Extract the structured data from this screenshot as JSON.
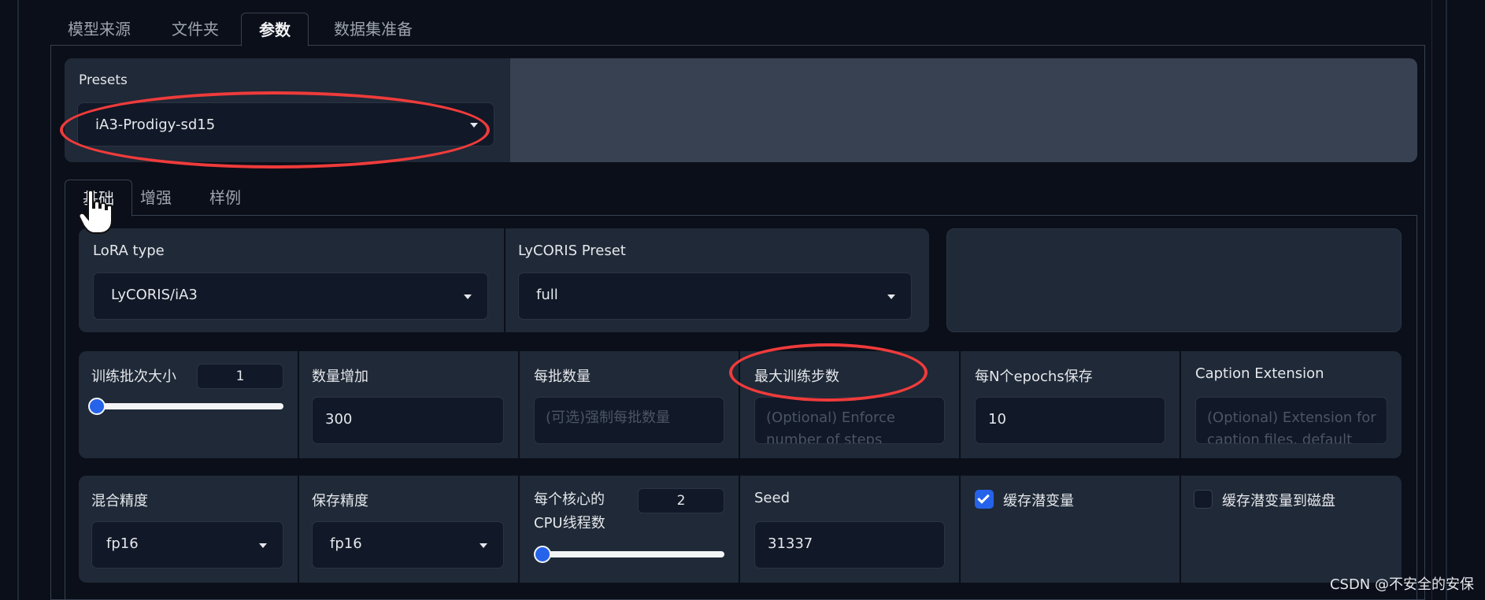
{
  "top_tabs": [
    {
      "label": "模型来源"
    },
    {
      "label": "文件夹"
    },
    {
      "label": "参数"
    },
    {
      "label": "数据集准备"
    }
  ],
  "presets": {
    "label": "Presets",
    "value": "iA3-Prodigy-sd15"
  },
  "sub_tabs": [
    {
      "label": "基础"
    },
    {
      "label": "增强"
    },
    {
      "label": "样例"
    }
  ],
  "lora": {
    "type_label": "LoRA type",
    "type_value": "LyCORIS/iA3",
    "preset_label": "LyCORIS Preset",
    "preset_value": "full"
  },
  "row2": {
    "batch_label": "训练批次大小",
    "batch_value": "1",
    "batch_slider_fraction": 0.0,
    "repeat_label": "数量增加",
    "repeat_value": "300",
    "per_batch_label": "每批数量",
    "per_batch_placeholder": "(可选)强制每批数量",
    "max_steps_label": "最大训练步数",
    "max_steps_placeholder": "(Optional) Enforce number of steps",
    "save_every_label": "每N个epochs保存",
    "save_every_value": "10",
    "caption_ext_label": "Caption Extension",
    "caption_ext_placeholder": "(Optional) Extension for caption files. default"
  },
  "row3": {
    "mixed_precision_label": "混合精度",
    "mixed_precision_value": "fp16",
    "save_precision_label": "保存精度",
    "save_precision_value": "fp16",
    "cpu_threads_label_1": "每个核心的",
    "cpu_threads_label_2": "CPU线程数",
    "cpu_threads_value": "2",
    "cpu_threads_slider_fraction": 0.02,
    "seed_label": "Seed",
    "seed_value": "31337",
    "cache_latents_label": "缓存潜变量",
    "cache_latents_checked": true,
    "cache_latents_disk_label": "缓存潜变量到磁盘",
    "cache_latents_disk_checked": false
  },
  "colors": {
    "background": "#0b0f19",
    "panel": "#1f2937",
    "input": "#111827",
    "accent": "#2563eb",
    "annotation": "#ef3b3b"
  },
  "watermark": "CSDN @不安全的安保"
}
